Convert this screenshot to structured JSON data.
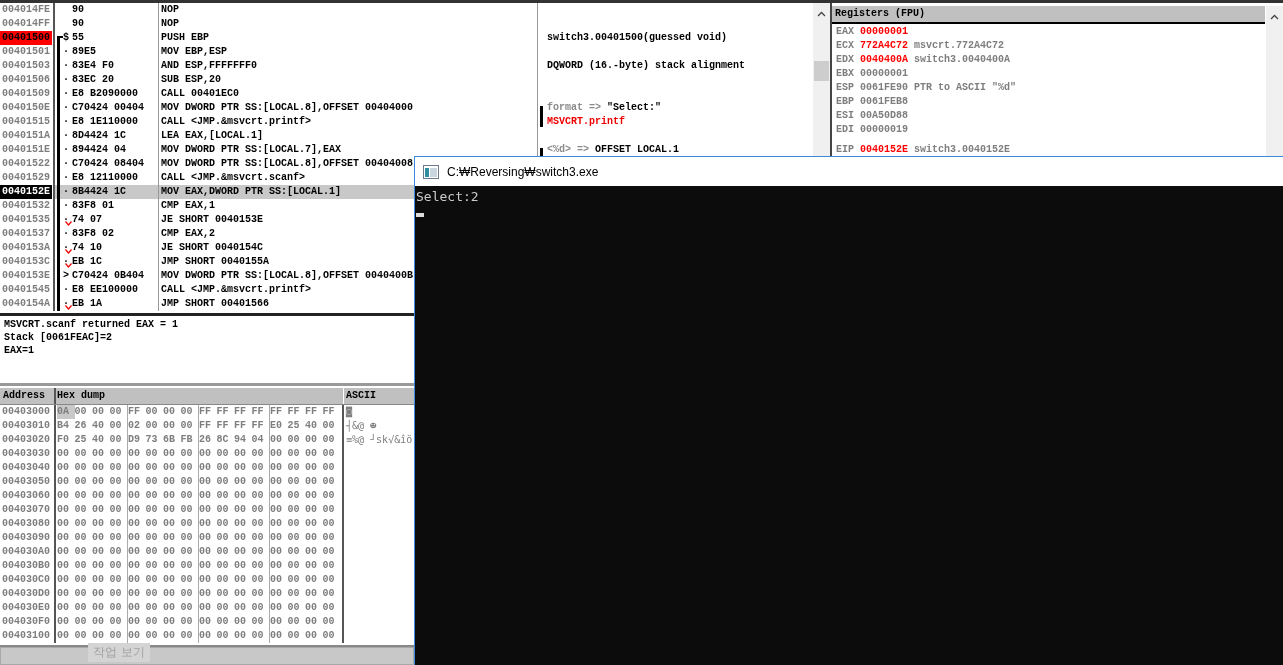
{
  "disassembly": {
    "rows": [
      {
        "address": "004014FE",
        "breakpoint": false,
        "current": false,
        "function_start": false,
        "in_function": false,
        "marker": "",
        "jump": false,
        "hex": "90",
        "instruction": "NOP",
        "selected": false
      },
      {
        "address": "004014FF",
        "breakpoint": false,
        "current": false,
        "function_start": false,
        "in_function": false,
        "marker": "",
        "jump": false,
        "hex": "90",
        "instruction": "NOP",
        "selected": false
      },
      {
        "address": "00401500",
        "breakpoint": true,
        "current": false,
        "function_start": true,
        "in_function": true,
        "marker": "$",
        "jump": false,
        "hex": "55",
        "instruction": "PUSH EBP",
        "selected": false,
        "comment": {
          "parts": [
            {
              "text": "switch3.00401500(guessed void)",
              "kind": "value"
            }
          ]
        }
      },
      {
        "address": "00401501",
        "breakpoint": false,
        "current": false,
        "function_start": false,
        "in_function": true,
        "marker": "·",
        "jump": false,
        "hex": "89E5",
        "instruction": "MOV EBP,ESP",
        "selected": false
      },
      {
        "address": "00401503",
        "breakpoint": false,
        "current": false,
        "function_start": false,
        "in_function": true,
        "marker": "·",
        "jump": false,
        "hex": "83E4 F0",
        "instruction": "AND ESP,FFFFFFF0",
        "selected": false,
        "comment": {
          "parts": [
            {
              "text": "DQWORD (16.-byte) stack alignment",
              "kind": "value"
            }
          ]
        }
      },
      {
        "address": "00401506",
        "breakpoint": false,
        "current": false,
        "function_start": false,
        "in_function": true,
        "marker": "·",
        "jump": false,
        "hex": "83EC 20",
        "instruction": "SUB ESP,20",
        "selected": false
      },
      {
        "address": "00401509",
        "breakpoint": false,
        "current": false,
        "function_start": false,
        "in_function": true,
        "marker": "·",
        "jump": false,
        "hex": "E8 B2090000",
        "instruction": "CALL 00401EC0",
        "selected": false
      },
      {
        "address": "0040150E",
        "breakpoint": false,
        "current": false,
        "function_start": false,
        "in_function": true,
        "marker": "·",
        "jump": false,
        "hex": "C70424 00404",
        "instruction": "MOV DWORD PTR SS:[LOCAL.8],OFFSET 00404000",
        "selected": false,
        "comment": {
          "bracket_start": true,
          "parts": [
            {
              "text": "format =>",
              "kind": "label"
            },
            {
              "text": "\"Select:\"",
              "kind": "value"
            }
          ]
        }
      },
      {
        "address": "00401515",
        "breakpoint": false,
        "current": false,
        "function_start": false,
        "in_function": true,
        "marker": "·",
        "jump": false,
        "hex": "E8 1E110000",
        "instruction": "CALL <JMP.&msvcrt.printf>",
        "selected": false,
        "comment": {
          "bracket_end": true,
          "parts": [
            {
              "text": "MSVCRT.printf",
              "kind": "call"
            }
          ]
        }
      },
      {
        "address": "0040151A",
        "breakpoint": false,
        "current": false,
        "function_start": false,
        "in_function": true,
        "marker": "·",
        "jump": false,
        "hex": "8D4424 1C",
        "instruction": "LEA EAX,[LOCAL.1]",
        "selected": false
      },
      {
        "address": "0040151E",
        "breakpoint": false,
        "current": false,
        "function_start": false,
        "in_function": true,
        "marker": "·",
        "jump": false,
        "hex": "894424 04",
        "instruction": "MOV DWORD PTR SS:[LOCAL.7],EAX",
        "selected": false,
        "comment": {
          "bracket_start": true,
          "parts": [
            {
              "text": "<%d> =>",
              "kind": "label"
            },
            {
              "text": "OFFSET LOCAL.1",
              "kind": "value"
            }
          ]
        }
      },
      {
        "address": "00401522",
        "breakpoint": false,
        "current": false,
        "function_start": false,
        "in_function": true,
        "marker": "·",
        "jump": false,
        "hex": "C70424 08404",
        "instruction": "MOV DWORD PTR SS:[LOCAL.8],OFFSET 00404008",
        "selected": false
      },
      {
        "address": "00401529",
        "breakpoint": false,
        "current": false,
        "function_start": false,
        "in_function": true,
        "marker": "·",
        "jump": false,
        "hex": "E8 12110000",
        "instruction": "CALL <JMP.&msvcrt.scanf>",
        "selected": false
      },
      {
        "address": "0040152E",
        "breakpoint": false,
        "current": true,
        "function_start": false,
        "in_function": true,
        "marker": "·",
        "jump": false,
        "hex": "8B4424 1C",
        "instruction": "MOV EAX,DWORD PTR SS:[LOCAL.1]",
        "selected": true
      },
      {
        "address": "00401532",
        "breakpoint": false,
        "current": false,
        "function_start": false,
        "in_function": true,
        "marker": "·",
        "jump": false,
        "hex": "83F8 01",
        "instruction": "CMP EAX,1",
        "selected": false
      },
      {
        "address": "00401535",
        "breakpoint": false,
        "current": false,
        "function_start": false,
        "in_function": true,
        "marker": "·",
        "jump": true,
        "hex": "74 07",
        "instruction": "JE SHORT 0040153E",
        "selected": false
      },
      {
        "address": "00401537",
        "breakpoint": false,
        "current": false,
        "function_start": false,
        "in_function": true,
        "marker": "·",
        "jump": false,
        "hex": "83F8 02",
        "instruction": "CMP EAX,2",
        "selected": false
      },
      {
        "address": "0040153A",
        "breakpoint": false,
        "current": false,
        "function_start": false,
        "in_function": true,
        "marker": "·",
        "jump": true,
        "hex": "74 10",
        "instruction": "JE SHORT 0040154C",
        "selected": false
      },
      {
        "address": "0040153C",
        "breakpoint": false,
        "current": false,
        "function_start": false,
        "in_function": true,
        "marker": "·",
        "jump": true,
        "hex": "EB 1C",
        "instruction": "JMP SHORT 0040155A",
        "selected": false
      },
      {
        "address": "0040153E",
        "breakpoint": false,
        "current": false,
        "function_start": false,
        "in_function": true,
        "marker": ">",
        "jump": false,
        "hex": "C70424 0B404",
        "instruction": "MOV DWORD PTR SS:[LOCAL.8],OFFSET 0040400B",
        "selected": false
      },
      {
        "address": "00401545",
        "breakpoint": false,
        "current": false,
        "function_start": false,
        "in_function": true,
        "marker": "·",
        "jump": false,
        "hex": "E8 EE100000",
        "instruction": "CALL <JMP.&msvcrt.printf>",
        "selected": false
      },
      {
        "address": "0040154A",
        "breakpoint": false,
        "current": false,
        "function_start": false,
        "in_function": true,
        "marker": "·",
        "jump": true,
        "hex": "EB 1A",
        "instruction": "JMP SHORT 00401566",
        "selected": false
      }
    ]
  },
  "info_pane": {
    "lines": [
      "MSVCRT.scanf returned EAX = 1",
      "Stack [0061FEAC]=2",
      "EAX=1"
    ]
  },
  "hex_dump": {
    "columns": [
      "Address",
      "Hex dump",
      "ASCII"
    ],
    "rows": [
      {
        "address": "00403000",
        "bytes": "0A 00 00 00 FF 00 00 00 FF FF FF FF FF FF FF FF",
        "ascii": "◙",
        "cursor": true
      },
      {
        "address": "00403010",
        "bytes": "B4 26 40 00 02 00 00 00 FF FF FF FF E0 25 40 00",
        "ascii": "┤&@ ☻",
        "cursor": false
      },
      {
        "address": "00403020",
        "bytes": "F0 25 40 00 D9 73 6B FB 26 8C 94 04 00 00 00 00",
        "ascii": "≡%@ ┘sk√&îö",
        "cursor": false
      },
      {
        "address": "00403030",
        "bytes": "00 00 00 00 00 00 00 00 00 00 00 00 00 00 00 00",
        "cursor": false
      },
      {
        "address": "00403040",
        "bytes": "00 00 00 00 00 00 00 00 00 00 00 00 00 00 00 00",
        "cursor": false
      },
      {
        "address": "00403050",
        "bytes": "00 00 00 00 00 00 00 00 00 00 00 00 00 00 00 00",
        "cursor": false
      },
      {
        "address": "00403060",
        "bytes": "00 00 00 00 00 00 00 00 00 00 00 00 00 00 00 00",
        "cursor": false
      },
      {
        "address": "00403070",
        "bytes": "00 00 00 00 00 00 00 00 00 00 00 00 00 00 00 00",
        "cursor": false
      },
      {
        "address": "00403080",
        "bytes": "00 00 00 00 00 00 00 00 00 00 00 00 00 00 00 00",
        "cursor": false
      },
      {
        "address": "00403090",
        "bytes": "00 00 00 00 00 00 00 00 00 00 00 00 00 00 00 00",
        "cursor": false
      },
      {
        "address": "004030A0",
        "bytes": "00 00 00 00 00 00 00 00 00 00 00 00 00 00 00 00",
        "cursor": false
      },
      {
        "address": "004030B0",
        "bytes": "00 00 00 00 00 00 00 00 00 00 00 00 00 00 00 00",
        "cursor": false
      },
      {
        "address": "004030C0",
        "bytes": "00 00 00 00 00 00 00 00 00 00 00 00 00 00 00 00",
        "cursor": false
      },
      {
        "address": "004030D0",
        "bytes": "00 00 00 00 00 00 00 00 00 00 00 00 00 00 00 00",
        "cursor": false
      },
      {
        "address": "004030E0",
        "bytes": "00 00 00 00 00 00 00 00 00 00 00 00 00 00 00 00",
        "cursor": false
      },
      {
        "address": "004030F0",
        "bytes": "00 00 00 00 00 00 00 00 00 00 00 00 00 00 00 00",
        "cursor": false
      },
      {
        "address": "00403100",
        "bytes": "00 00 00 00 00 00 00 00 00 00 00 00 00 00 00 00",
        "cursor": false
      }
    ]
  },
  "registers": {
    "title": "Registers (FPU)",
    "groups": [
      [
        {
          "name": "EAX",
          "value": "00000001",
          "changed": true
        },
        {
          "name": "ECX",
          "value": "772A4C72",
          "changed": true,
          "comment": "msvcrt.772A4C72"
        },
        {
          "name": "EDX",
          "value": "0040400A",
          "changed": true,
          "comment": "switch3.0040400A"
        },
        {
          "name": "EBX",
          "value": "00000001",
          "changed": false
        },
        {
          "name": "ESP",
          "value": "0061FE90",
          "changed": false,
          "comment": "PTR to ASCII \"%d\""
        },
        {
          "name": "EBP",
          "value": "0061FEB8",
          "changed": false
        },
        {
          "name": "ESI",
          "value": "00A50D88",
          "changed": false
        },
        {
          "name": "EDI",
          "value": "00000019",
          "changed": false
        }
      ],
      [
        {
          "name": "EIP",
          "value": "0040152E",
          "changed": true,
          "comment": "switch3.0040152E"
        }
      ]
    ]
  },
  "tooltip": "작업 보기",
  "console": {
    "title": "C:₩Reversing₩switch3.exe",
    "lines": [
      "Select:2"
    ],
    "cursor": true
  }
}
